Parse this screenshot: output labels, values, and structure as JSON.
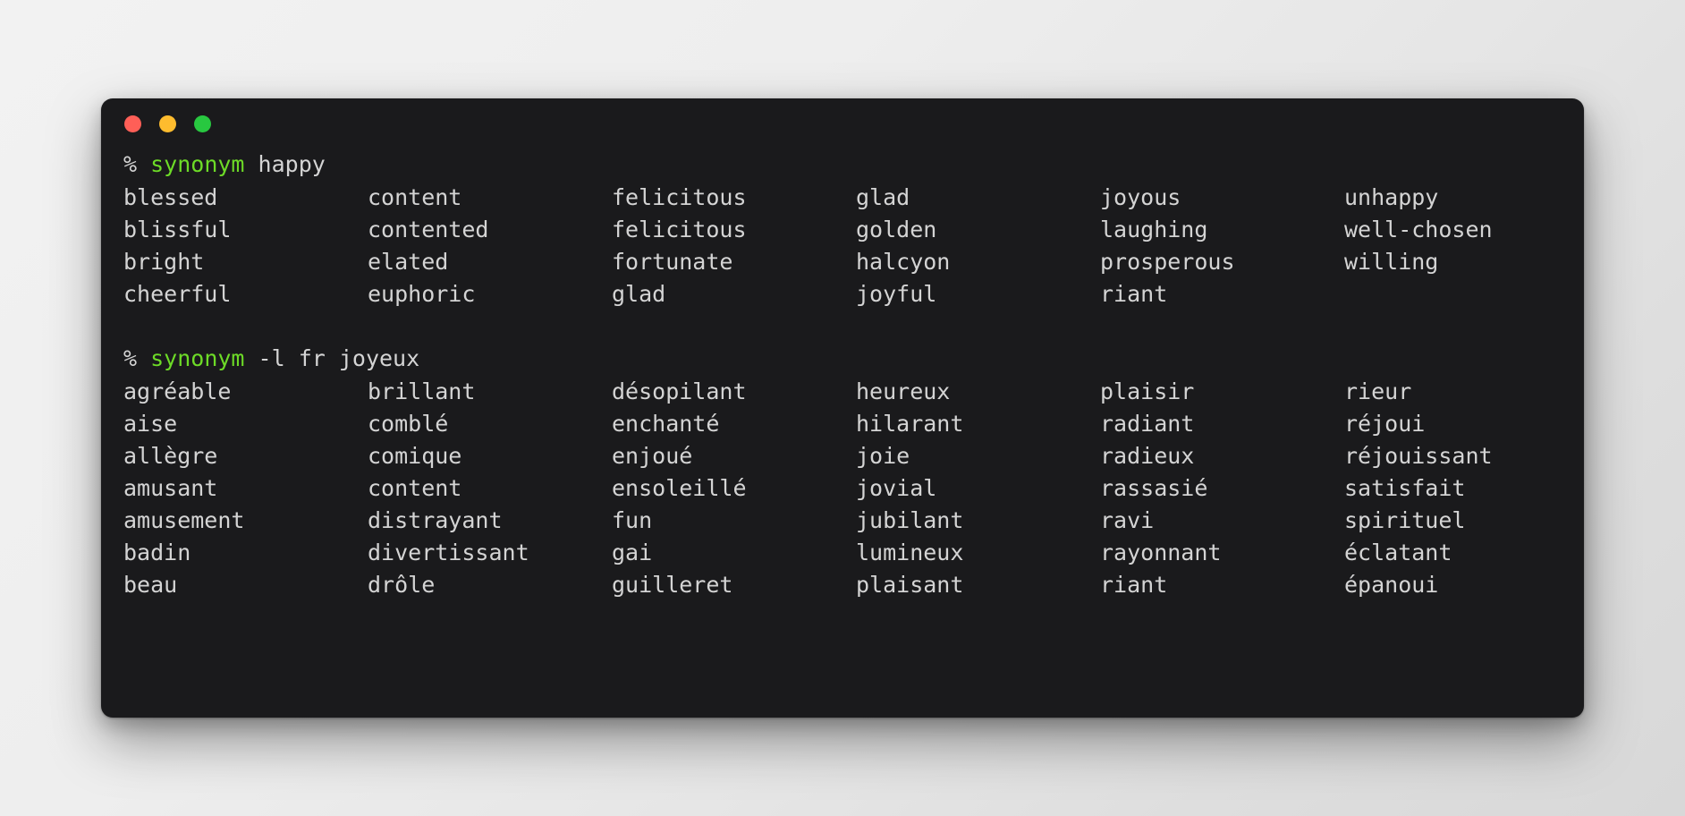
{
  "window": {
    "traffic_lights": [
      {
        "name": "close-button",
        "color": "#ff5f57"
      },
      {
        "name": "minimize-button",
        "color": "#febc2e"
      },
      {
        "name": "maximize-button",
        "color": "#28c840"
      }
    ],
    "background_color": "#1a1a1c",
    "text_color": "#d4d4d4",
    "accent_color": "#6ddb27"
  },
  "sessions": [
    {
      "prompt_sigil": "%",
      "command_name": "synonym",
      "command_args": "happy",
      "columns": [
        [
          "blessed",
          "blissful",
          "bright",
          "cheerful"
        ],
        [
          "content",
          "contented",
          "elated",
          "euphoric"
        ],
        [
          "felicitous",
          "felicitous",
          "fortunate",
          "glad"
        ],
        [
          "glad",
          "golden",
          "halcyon",
          "joyful"
        ],
        [
          "joyous",
          "laughing",
          "prosperous",
          "riant"
        ],
        [
          "unhappy",
          "well-chosen",
          "willing",
          ""
        ]
      ]
    },
    {
      "prompt_sigil": "%",
      "command_name": "synonym",
      "command_args": "-l fr joyeux",
      "columns": [
        [
          "agréable",
          "aise",
          "allègre",
          "amusant",
          "amusement",
          "badin",
          "beau"
        ],
        [
          "brillant",
          "comblé",
          "comique",
          "content",
          "distrayant",
          "divertissant",
          "drôle"
        ],
        [
          "désopilant",
          "enchanté",
          "enjoué",
          "ensoleillé",
          "fun",
          "gai",
          "guilleret"
        ],
        [
          "heureux",
          "hilarant",
          "joie",
          "jovial",
          "jubilant",
          "lumineux",
          "plaisant"
        ],
        [
          "plaisir",
          "radiant",
          "radieux",
          "rassasié",
          "ravi",
          "rayonnant",
          "riant"
        ],
        [
          "rieur",
          "réjoui",
          "réjouissant",
          "satisfait",
          "spirituel",
          "éclatant",
          "épanoui"
        ]
      ]
    }
  ]
}
